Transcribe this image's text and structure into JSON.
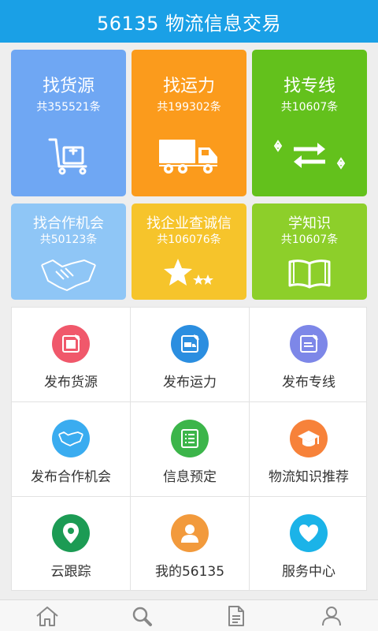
{
  "header": {
    "title": "56135 物流信息交易"
  },
  "tiles": [
    {
      "title": "找货源",
      "count": "共355521条",
      "color": "#6fa7f3",
      "icon": "hand-truck-icon"
    },
    {
      "title": "找运力",
      "count": "共199302条",
      "color": "#fb9b1c",
      "icon": "truck-icon"
    },
    {
      "title": "找专线",
      "count": "共10607条",
      "color": "#63c11c",
      "icon": "route-arrows-icon"
    },
    {
      "title": "找合作机会",
      "count": "共50123条",
      "color": "#8fc6f6",
      "icon": "handshake-icon"
    },
    {
      "title": "找企业查诚信",
      "count": "共106076条",
      "color": "#f6c42b",
      "icon": "stars-icon"
    },
    {
      "title": "学知识",
      "count": "共10607条",
      "color": "#8dcf2a",
      "icon": "book-icon"
    }
  ],
  "grid": [
    {
      "label": "发布货源",
      "icon": "publish-goods-icon",
      "color": "#f0586b"
    },
    {
      "label": "发布运力",
      "icon": "publish-truck-icon",
      "color": "#2b8ee0"
    },
    {
      "label": "发布专线",
      "icon": "publish-line-icon",
      "color": "#7d87e8"
    },
    {
      "label": "发布合作机会",
      "icon": "handshake-icon",
      "color": "#3aacf0"
    },
    {
      "label": "信息预定",
      "icon": "list-icon",
      "color": "#3cb54a"
    },
    {
      "label": "物流知识推荐",
      "icon": "graduation-cap-icon",
      "color": "#f7823a"
    },
    {
      "label": "云跟踪",
      "icon": "location-pin-icon",
      "color": "#1c9b54"
    },
    {
      "label": "我的56135",
      "icon": "user-icon",
      "color": "#f29a3c"
    },
    {
      "label": "服务中心",
      "icon": "heart-icon",
      "color": "#1bb3e8"
    }
  ],
  "tabbar": [
    {
      "name": "home",
      "icon": "home-icon"
    },
    {
      "name": "search",
      "icon": "search-icon"
    },
    {
      "name": "document",
      "icon": "document-icon"
    },
    {
      "name": "profile",
      "icon": "user-icon"
    }
  ]
}
